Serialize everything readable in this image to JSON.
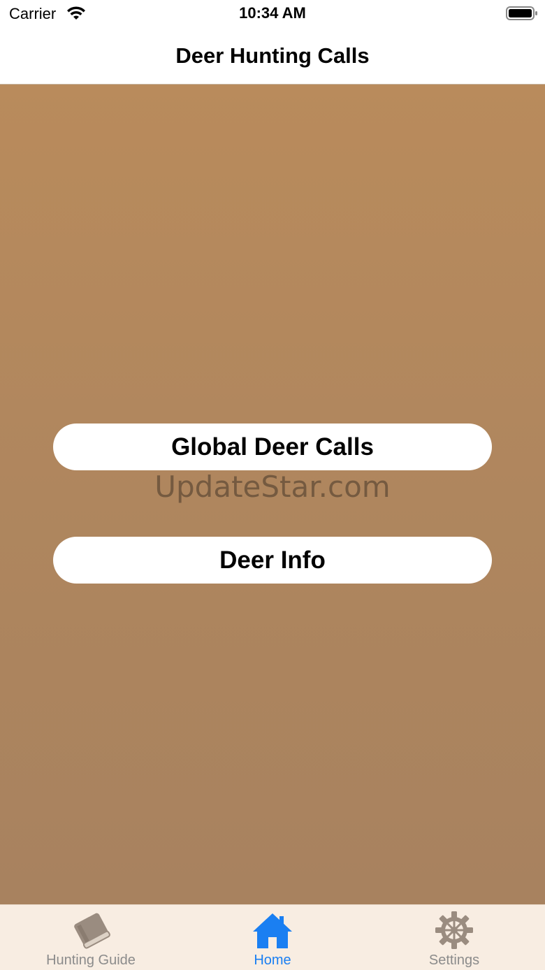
{
  "status_bar": {
    "carrier": "Carrier",
    "time": "10:34 AM"
  },
  "nav": {
    "title": "Deer Hunting Calls"
  },
  "main": {
    "buttons": [
      {
        "label": "Global Deer Calls"
      },
      {
        "label": "Deer Info"
      }
    ],
    "watermark": "UpdateStar.com"
  },
  "tab_bar": {
    "active_index": 1,
    "items": [
      {
        "label": "Hunting Guide",
        "icon": "book-icon"
      },
      {
        "label": "Home",
        "icon": "house-icon"
      },
      {
        "label": "Settings",
        "icon": "gear-icon"
      }
    ]
  },
  "colors": {
    "background": "#af865e",
    "tab_active": "#1a7ff2",
    "tab_inactive": "#8b8b8b",
    "tab_bar_bg": "#f8ede2"
  }
}
